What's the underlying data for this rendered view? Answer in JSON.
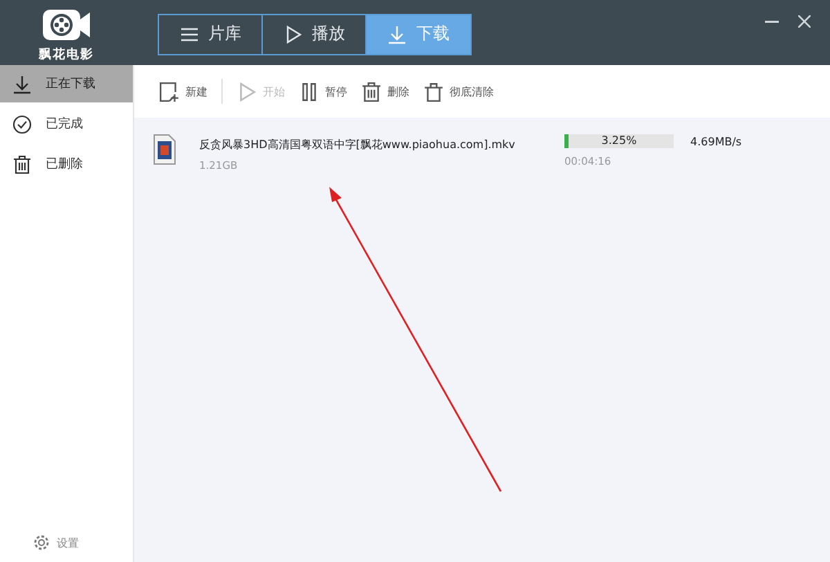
{
  "app": {
    "logo_text": "飘花电影"
  },
  "tabs": [
    {
      "label": "片库",
      "kind": "list",
      "selected": false
    },
    {
      "label": "播放",
      "kind": "play",
      "selected": false
    },
    {
      "label": "下载",
      "kind": "download",
      "selected": true
    }
  ],
  "sidebar": {
    "items": [
      {
        "label": "正在下载",
        "kind": "download",
        "selected": true
      },
      {
        "label": "已完成",
        "kind": "check",
        "selected": false
      },
      {
        "label": "已删除",
        "kind": "trash",
        "selected": false
      }
    ],
    "settings": "设置"
  },
  "toolbar": [
    {
      "label": "新建",
      "kind": "new",
      "disabled": false
    },
    {
      "label": "开始",
      "kind": "play",
      "disabled": true
    },
    {
      "label": "暂停",
      "kind": "pause",
      "disabled": false
    },
    {
      "label": "删除",
      "kind": "trash",
      "disabled": false
    },
    {
      "label": "彻底清除",
      "kind": "clear",
      "disabled": false
    }
  ],
  "downloads": [
    {
      "name": "反贪风暴3HD高清国粤双语中字[飘花www.piaohua.com].mkv",
      "size": "1.21GB",
      "level": 0.0325,
      "percent": "3.25%",
      "elapsed": "00:04:16",
      "speed": "4.69MB/s"
    }
  ]
}
